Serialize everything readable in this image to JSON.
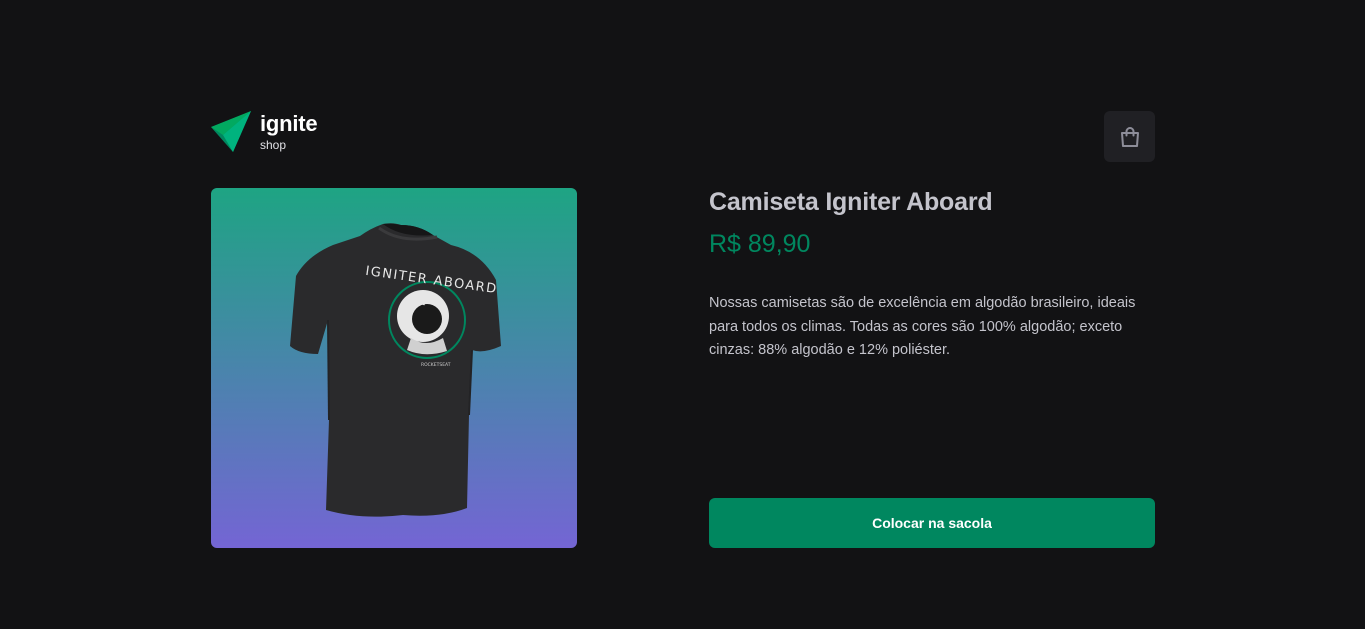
{
  "header": {
    "logo_word": "ignite",
    "logo_sub": "shop",
    "cart_icon": "shopping-bag-icon"
  },
  "product": {
    "title": "Camiseta Igniter Aboard",
    "price": "R$ 89,90",
    "description": "Nossas camisetas são de excelência em algodão brasileiro, ideais para todos os climas. Todas as cores são 100% algodão; exceto cinzas: 88% algodão e 12% poliéster.",
    "buy_label": "Colocar na sacola",
    "image_print_text": "IGNITER ABOARD",
    "image_print_small": "ROCKETSEAT"
  },
  "colors": {
    "background": "#121214",
    "accent": "#00875f",
    "gradient_top": "#1ea483",
    "gradient_bottom": "#7465d4"
  }
}
